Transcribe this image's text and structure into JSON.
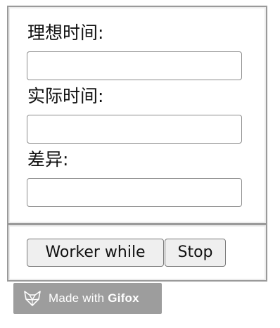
{
  "fields": [
    {
      "label": "理想时间:",
      "value": ""
    },
    {
      "label": "实际时间:",
      "value": ""
    },
    {
      "label": "差异:",
      "value": ""
    }
  ],
  "buttons": {
    "worker_while": "Worker while",
    "stop": "Stop"
  },
  "badge": {
    "prefix": "Made with",
    "brand": "Gifox",
    "icon": "fox-icon"
  },
  "colors": {
    "badge_background": "#9d9d9d",
    "button_background": "#efefef",
    "panel_border": "#9a9a9a"
  }
}
